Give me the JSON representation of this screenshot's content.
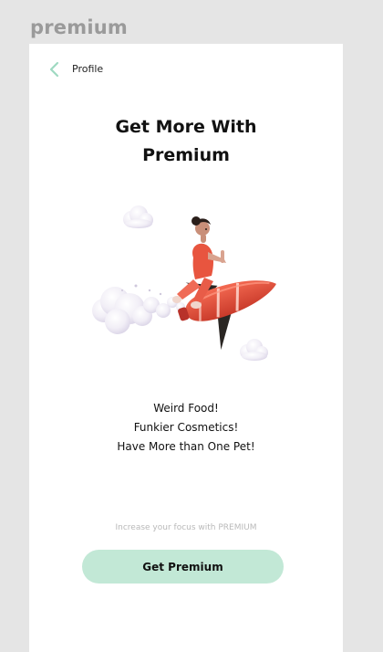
{
  "frame": {
    "title": "premium"
  },
  "header": {
    "back_label": "Profile"
  },
  "main": {
    "headline_line1": "Get More With",
    "headline_line2": "Premium",
    "perks": [
      "Weird Food!",
      "Funkier Cosmetics!",
      "Have More than One Pet!"
    ],
    "focus_text": "Increase your focus with PREMIUM",
    "cta_label": "Get Premium"
  },
  "colors": {
    "accent": "#c2e8d6",
    "back_chevron": "#9fd9c2",
    "rocket": "#e9553f"
  }
}
